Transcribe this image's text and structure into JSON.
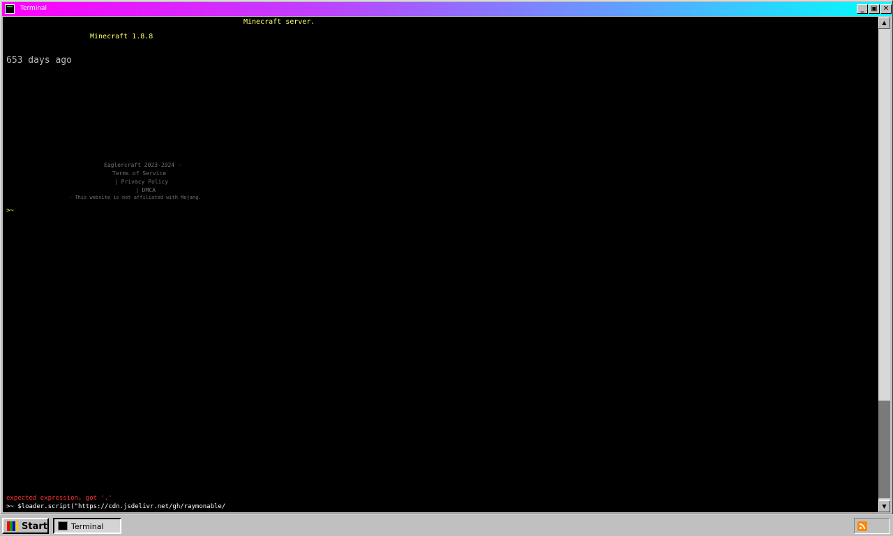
{
  "window": {
    "title": "Terminal"
  },
  "terminal": {
    "header_server": "Minecraft server.",
    "version": "Minecraft 1.8.8",
    "days_ago": "653 days ago",
    "footer": {
      "copyright": "Eaglercraft 2023-2024 -",
      "terms": "Terms of Service",
      "privacy": "| Privacy Policy",
      "dmca": "| DMCA",
      "disclaimer": "- This website is not affiliated with Mojang."
    },
    "prompt_1": ">~",
    "error_line": "expected expression, got '.'",
    "command_line": ">~ $loader.script(\"https://cdn.jsdelivr.net/gh/raymonable/"
  },
  "taskbar": {
    "start_label": "Start",
    "task_label": "Terminal"
  },
  "icons": {
    "app": "terminal-icon",
    "start": "windows-logo-icon",
    "tray": "rss-icon"
  }
}
